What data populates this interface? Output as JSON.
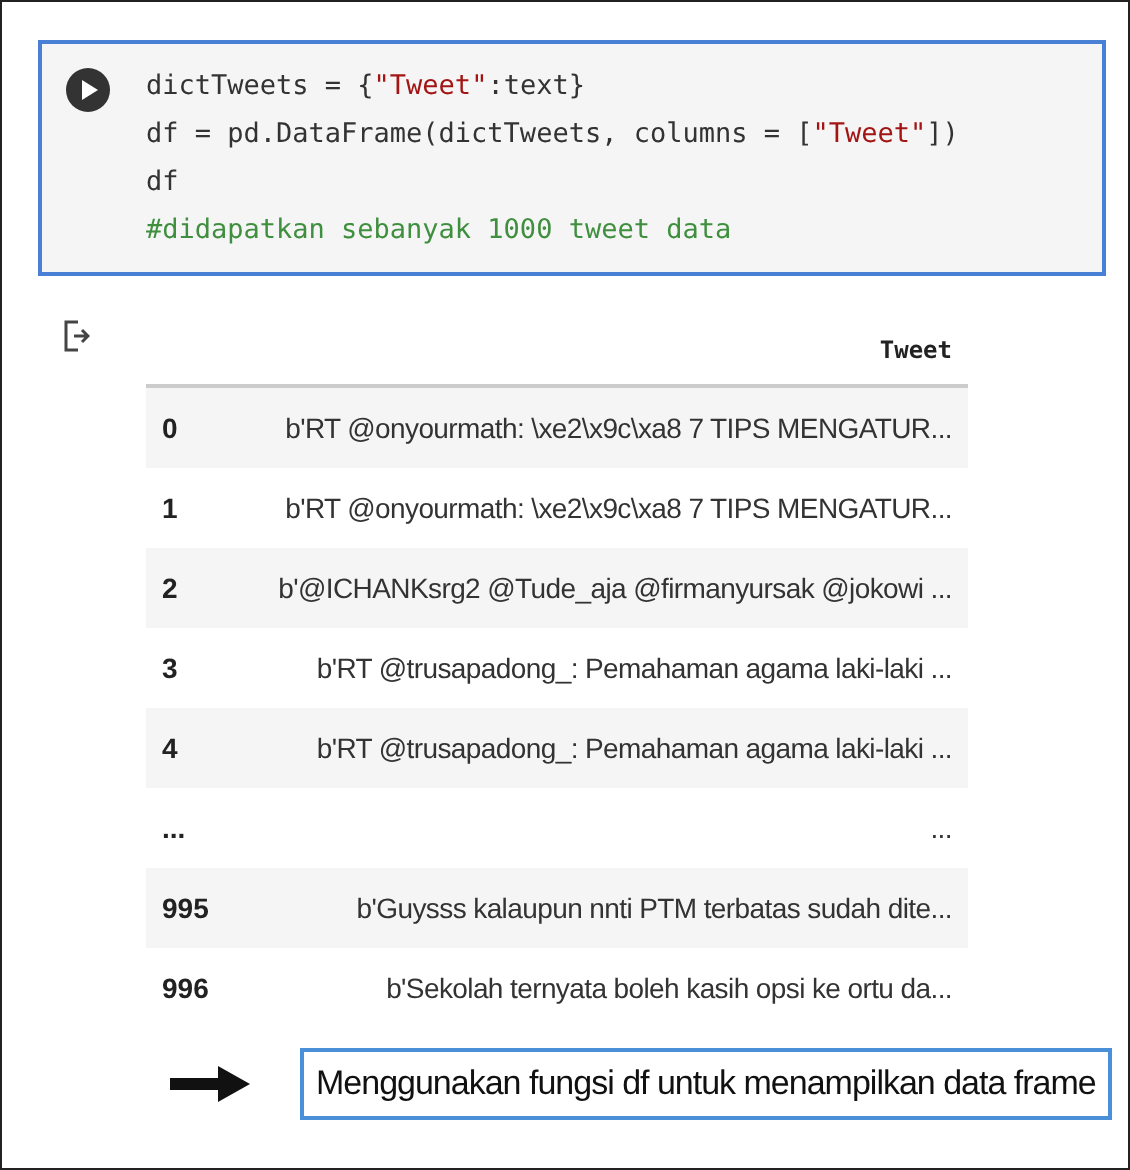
{
  "code_cell": {
    "lines": [
      [
        {
          "kind": "plain",
          "text": "dictTweets = {"
        },
        {
          "kind": "string",
          "text": "\"Tweet\""
        },
        {
          "kind": "plain",
          "text": ":text}"
        }
      ],
      [
        {
          "kind": "plain",
          "text": "df = pd.DataFrame(dictTweets, columns = ["
        },
        {
          "kind": "string",
          "text": "\"Tweet\""
        },
        {
          "kind": "plain",
          "text": "])"
        }
      ],
      [
        {
          "kind": "plain",
          "text": "df"
        }
      ],
      [
        {
          "kind": "comment",
          "text": "#didapatkan sebanyak 1000 tweet data"
        }
      ]
    ]
  },
  "table": {
    "columns": [
      "Tweet"
    ],
    "rows": [
      {
        "index": "0",
        "tweet": "b'RT @onyourmath: \\xe2\\x9c\\xa8 7 TIPS MENGATUR..."
      },
      {
        "index": "1",
        "tweet": "b'RT @onyourmath: \\xe2\\x9c\\xa8 7 TIPS MENGATUR..."
      },
      {
        "index": "2",
        "tweet": "b'@ICHANKsrg2 @Tude_aja @firmanyursak @jokowi ..."
      },
      {
        "index": "3",
        "tweet": "b'RT @trusapadong_: Pemahaman agama laki-laki ..."
      },
      {
        "index": "4",
        "tweet": "b'RT @trusapadong_: Pemahaman agama laki-laki ..."
      },
      {
        "index": "...",
        "tweet": "..."
      },
      {
        "index": "995",
        "tweet": "b'Guysss kalaupun nnti PTM terbatas sudah dite..."
      },
      {
        "index": "996",
        "tweet": "b'Sekolah ternyata boleh kasih opsi ke ortu da..."
      }
    ]
  },
  "caption": "Menggunakan fungsi df untuk menampilkan data frame"
}
